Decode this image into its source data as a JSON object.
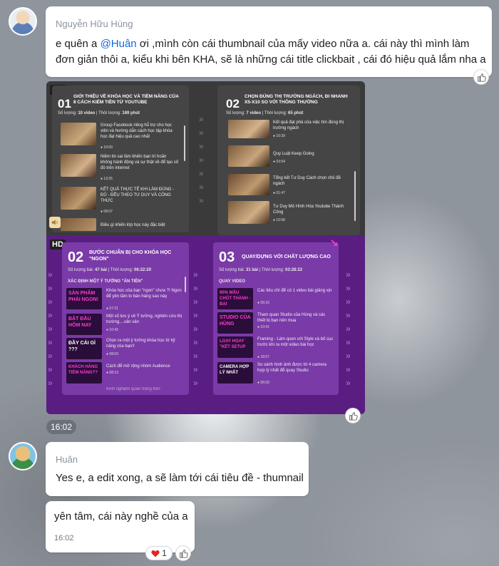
{
  "message1": {
    "sender": "Nguyễn Hữu Hùng",
    "text_before": "e quên a ",
    "mention": "@Huân",
    "text_after": " ơi ,mình còn cái thumbnail của mấy video nữa a. cái này thì mình làm đơn giản thôi a, kiểu khi bên KHA, sẽ là những cái title clickbait , cái đó hiệu quả lắm nha a"
  },
  "attachment": {
    "hd_label": "HD",
    "thumb1": {
      "left": {
        "num": "01",
        "title": "GIỚI THIỆU VỀ KHÓA HỌC VÀ TIỀM NĂNG CỦA 8 CÁCH KIẾM TIỀN TỪ YOUTUBE",
        "meta_count_label": "Số lượng: ",
        "meta_count": "10 video",
        "meta_time_label": "Thời lượng: ",
        "meta_time": "169 phút",
        "items": [
          {
            "text": "Group Facebook riêng hỗ trợ cho học viên và hướng dẫn cách học tập khóa học đạt hiệu quả cao nhất",
            "dur": "10:00"
          },
          {
            "text": "Niềm tin sai lầm khiến bạn trì hoãn không hành động và sự thật về để tạo số đô trên internet",
            "dur": "13:25"
          },
          {
            "text": "KẾT QUẢ THỰC TẾ KHI LÀM ĐÚNG - ĐỦ - ĐỀU THEO TƯ DUY VÀ CÔNG THỨC",
            "dur": "08:07"
          },
          {
            "text": "Điều gì khiến lớp học này đặc biệt",
            "dur": ""
          }
        ]
      },
      "right": {
        "num": "02",
        "title": "CHỌN ĐÚNG THỊ TRƯỜNG NGÁCH, ĐI NHANH X5-X10 SO VỚI THÔNG THƯỜNG",
        "meta_count_label": "Số lượng: ",
        "meta_count": "7 video",
        "meta_time_label": "Thời lượng: ",
        "meta_time": "65 phút",
        "items": [
          {
            "text": "Kết quả đạt phá của việc tìm đúng thị trường ngách",
            "dur": "10:39"
          },
          {
            "text": "Quy Luật Keep Going",
            "dur": "03:54"
          },
          {
            "text": "Tổng kết Tư Duy Cách chọn chủ đề ngách",
            "dur": "01:47"
          },
          {
            "text": "Tư Duy Mô Hình Hóa Youtube Thành Công",
            "dur": "10:58"
          }
        ]
      }
    },
    "thumb2": {
      "left": {
        "num": "02",
        "title": "BƯỚC CHUẨN BỊ CHO KHÓA HỌC \"NGON\"",
        "meta_count_label": "Số lượng bài: ",
        "meta_count": "47 bài",
        "meta_time_label": "Thời lượng: ",
        "meta_time": "06:22:20",
        "section": "XÁC ĐỊNH MỘT Ý TƯỞNG \"ĂN TIỀN\"",
        "items": [
          {
            "thumb_text": "SẢN PHẨM PHẢI NGON!",
            "text": "Khóa học của bạn \"ngon\" chưa ?! Ngon để yên tâm lo bán hàng sau này",
            "dur": "07:21"
          },
          {
            "thumb_text": "BẮT ĐẦU HÔM NAY",
            "text": "Một số lưu ý về Ý tưởng, nghiên cứu thị trường....vân vân",
            "dur": "10:43"
          },
          {
            "thumb_text": "ĐẦY CÁI GÌ ???",
            "text": "Chọn ra một ý tưởng khóa học từ kỹ năng của bạn!!",
            "dur": "08:03"
          },
          {
            "thumb_text": "KHÁCH HÀNG TIỀM NĂNG??",
            "text": "Cách để mở rộng nhóm Audience",
            "dur": "08:13"
          }
        ],
        "cut_text": "Kinh nghiệm quan trọng trên"
      },
      "right": {
        "num": "03",
        "title": "QUAY/DỰNG VỚI CHẤT LƯỢNG CAO",
        "meta_count_label": "Số lượng bài: ",
        "meta_count": "31 bài",
        "meta_time_label": "Thời lượng: ",
        "meta_time": "03:28:22",
        "section": "QUAY VIDEO",
        "items": [
          {
            "thumb_text": "90% MẪU CHỐT THÀNH - BẠI",
            "text": "Các tiêu chí để có 1 video bài giảng xịn",
            "dur": "06:16"
          },
          {
            "thumb_text": "STUDIO CỦA HÙNG",
            "text": "Tham quan Studio của Hùng và các thiết bị bạn nên mua",
            "dur": "10:41"
          },
          {
            "thumb_text": "LOAY HOAY \"KẾT SETUP",
            "text": "Framing - Làm quen với Style và bố cục trước khi ra một video bài học",
            "dur": "18:57"
          },
          {
            "thumb_text": "CAMERA HỢP LÝ NHẤT",
            "text": "So sánh hình ảnh được từ 4 camera hợp lý nhất để quay Studio",
            "dur": "06:03"
          }
        ]
      }
    }
  },
  "time_pill": "16:02",
  "message2": {
    "sender": "Huân",
    "text": "Yes e, a edit xong, a sẽ làm tới cái tiêu đề - thumnail"
  },
  "message3": {
    "text": "yên tâm, cái này nghề của a",
    "time": "16:02"
  },
  "reaction": {
    "icon": "heart-icon",
    "count": "1"
  },
  "colors": {
    "mention": "#1466d8",
    "purple_bg": "#5a1e82",
    "dark_bg": "#3a3a3a",
    "heart": "#e02424"
  }
}
